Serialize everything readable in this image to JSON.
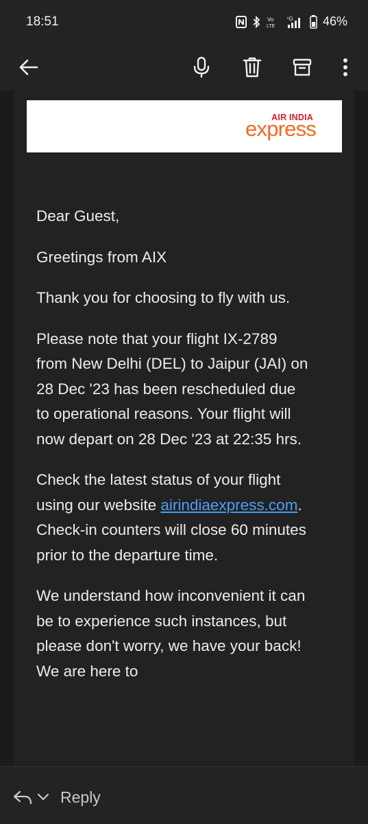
{
  "status_bar": {
    "time": "18:51",
    "network_label": "Vo LTE",
    "signal_label": "4G",
    "battery": "46%"
  },
  "toolbar": {
    "icons": [
      "back-arrow-icon",
      "microphone-icon",
      "delete-icon",
      "archive-icon",
      "more-vert-icon"
    ]
  },
  "email": {
    "logo": {
      "line1": "AIR INDIA",
      "line2": "express"
    },
    "greeting": "Dear Guest,",
    "line_greetings": "Greetings from AIX",
    "line_thanks": "Thank you for choosing to fly with us.",
    "paragraph_notice": "Please note that your flight IX-2789 from New Delhi (DEL) to Jaipur (JAI) on 28 Dec '23 has been rescheduled due to operational reasons. Your flight will now depart on 28 Dec '23 at 22:35 hrs.",
    "status_before_link": "Check the latest status of your flight using our website ",
    "status_link": "airindiaexpress.com",
    "status_after_link": ". Check-in counters will close 60 minutes prior to the departure time.",
    "paragraph_apology": "We understand how inconvenient it can be to experience such instances, but please don't worry, we have your back! We are here to"
  },
  "bottom_bar": {
    "reply_label": "Reply"
  },
  "colors": {
    "background": "#1b1b1b",
    "bars": "#232323",
    "link": "#4d9ef5",
    "logo_red": "#d91e2a",
    "logo_orange": "#ee6a25"
  }
}
